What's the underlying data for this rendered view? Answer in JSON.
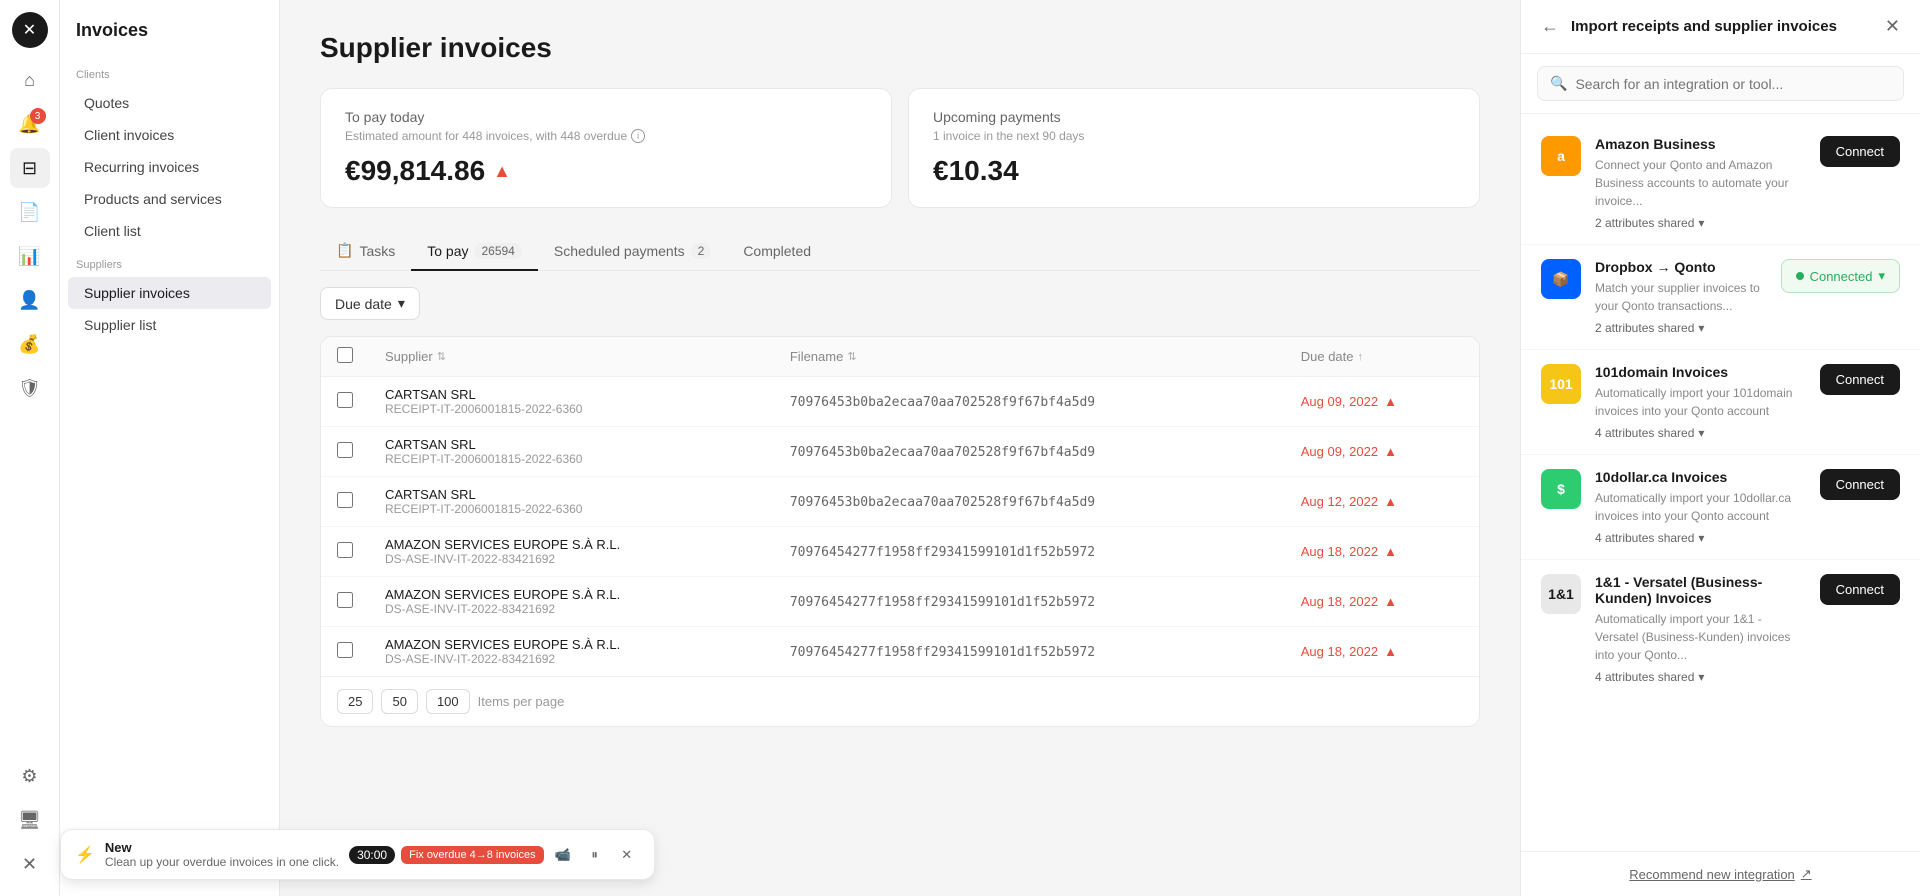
{
  "app": {
    "title": "Invoices"
  },
  "sidebar": {
    "title": "Invoices",
    "clients_label": "Clients",
    "clients_items": [
      {
        "id": "quotes",
        "label": "Quotes",
        "active": false
      },
      {
        "id": "client-invoices",
        "label": "Client invoices",
        "active": false
      },
      {
        "id": "recurring-invoices",
        "label": "Recurring invoices",
        "active": false
      },
      {
        "id": "products-services",
        "label": "Products and services",
        "active": false
      },
      {
        "id": "client-list",
        "label": "Client list",
        "active": false
      }
    ],
    "suppliers_label": "Suppliers",
    "suppliers_items": [
      {
        "id": "supplier-invoices",
        "label": "Supplier invoices",
        "active": true
      },
      {
        "id": "supplier-list",
        "label": "Supplier list",
        "active": false
      }
    ]
  },
  "main": {
    "page_title": "Supplier invoices",
    "cards": {
      "to_pay": {
        "title": "To pay today",
        "subtitle": "Estimated amount for 448 invoices, with 448 overdue",
        "amount": "€99,814.86",
        "warning": true
      },
      "upcoming": {
        "title": "Upcoming payments",
        "subtitle": "1 invoice in the next 90 days",
        "amount": "€10.34",
        "warning": false
      }
    },
    "tabs": [
      {
        "id": "tasks",
        "label": "Tasks",
        "icon": "📋",
        "badge": null,
        "active": false
      },
      {
        "id": "to-pay",
        "label": "To pay",
        "badge": "26594",
        "active": true
      },
      {
        "id": "scheduled",
        "label": "Scheduled payments",
        "badge": "2",
        "active": false
      },
      {
        "id": "completed",
        "label": "Completed",
        "badge": null,
        "active": false
      }
    ],
    "filter": {
      "label": "Due date",
      "icon": "▾"
    },
    "table": {
      "columns": [
        {
          "id": "checkbox",
          "label": ""
        },
        {
          "id": "supplier",
          "label": "Supplier"
        },
        {
          "id": "filename",
          "label": "Filename"
        },
        {
          "id": "due-date",
          "label": "Due date"
        }
      ],
      "rows": [
        {
          "supplier_name": "CARTSAN SRL",
          "supplier_ref": "RECEIPT-IT-2006001815-2022-6360",
          "filename": "70976453b0ba2ecaa70aa702528f9f67bf4a5d9",
          "due_date": "Aug 09, 2022",
          "overdue": true
        },
        {
          "supplier_name": "CARTSAN SRL",
          "supplier_ref": "RECEIPT-IT-2006001815-2022-6360",
          "filename": "70976453b0ba2ecaa70aa702528f9f67bf4a5d9",
          "due_date": "Aug 09, 2022",
          "overdue": true
        },
        {
          "supplier_name": "CARTSAN SRL",
          "supplier_ref": "RECEIPT-IT-2006001815-2022-6360",
          "filename": "70976453b0ba2ecaa70aa702528f9f67bf4a5d9",
          "due_date": "Aug 12, 2022",
          "overdue": true
        },
        {
          "supplier_name": "AMAZON SERVICES EUROPE S.À R.L.",
          "supplier_ref": "DS-ASE-INV-IT-2022-83421692",
          "filename": "70976454277f1958ff29341599101d1f52b5972",
          "due_date": "Aug 18, 2022",
          "overdue": true
        },
        {
          "supplier_name": "AMAZON SERVICES EUROPE S.À R.L.",
          "supplier_ref": "DS-ASE-INV-IT-2022-83421692",
          "filename": "70976454277f1958ff29341599101d1f52b5972",
          "due_date": "Aug 18, 2022",
          "overdue": true
        },
        {
          "supplier_name": "AMAZON SERVICES EUROPE S.À R.L.",
          "supplier_ref": "DS-ASE-INV-IT-2022-83421692",
          "filename": "70976454277f1958ff29341599101d1f52b5972",
          "due_date": "Aug 18, 2022",
          "overdue": true
        }
      ]
    },
    "pagination": {
      "options": [
        "25",
        "50",
        "100"
      ],
      "per_page_label": "Items per page"
    }
  },
  "right_panel": {
    "title": "Import receipts and supplier invoices",
    "search_placeholder": "Search for an integration or tool...",
    "integrations": [
      {
        "id": "amazon-business",
        "name": "Amazon Business",
        "description": "Connect your Qonto and Amazon Business accounts to automate your invoice...",
        "attrs": "2 attributes shared",
        "status": "connect",
        "logo_text": "a",
        "logo_bg": "#ff9900"
      },
      {
        "id": "dropbox-qonto",
        "name": "Dropbox → Qonto",
        "description": "Match your supplier invoices to your Qonto transactions...",
        "attrs": "2 attributes shared",
        "status": "connected",
        "logo_text": "📦",
        "logo_bg": "#0061ff"
      },
      {
        "id": "101domain",
        "name": "101domain Invoices",
        "description": "Automatically import your 101domain invoices into your Qonto account",
        "attrs": "4 attributes shared",
        "status": "connect",
        "logo_text": "101",
        "logo_bg": "#f5c518"
      },
      {
        "id": "10dollar",
        "name": "10dollar.ca Invoices",
        "description": "Automatically import your 10dollar.ca invoices into your Qonto account",
        "attrs": "4 attributes shared",
        "status": "connect",
        "logo_text": "$",
        "logo_bg": "#2ecc71"
      },
      {
        "id": "versatel",
        "name": "1&1 - Versatel (Business-Kunden) Invoices",
        "description": "Automatically import your 1&1 - Versatel (Business-Kunden) invoices into your Qonto...",
        "attrs": "4 attributes shared",
        "status": "connect",
        "logo_text": "1&1",
        "logo_bg": "#e8e8e8"
      }
    ],
    "footer_link": "Recommend new integration",
    "connected_label": "Connected",
    "connect_label": "Connect",
    "chevron_down": "▾"
  },
  "notification": {
    "icon": "⚡",
    "label": "New",
    "text": "Clean up your overdue invoices in one click.",
    "time": "30:00",
    "action_label": "Fix overdue 4→8 invoices",
    "controls": [
      "📹",
      "⏸",
      "✕"
    ]
  },
  "icon_bar": {
    "badge_count": "3",
    "items": [
      {
        "id": "home",
        "icon": "⊞",
        "label": "home"
      },
      {
        "id": "bell",
        "icon": "🔔",
        "label": "notifications",
        "badge": "3"
      },
      {
        "id": "dashboard",
        "icon": "⊡",
        "label": "dashboard"
      },
      {
        "id": "invoices",
        "icon": "📄",
        "label": "invoices"
      },
      {
        "id": "analytics",
        "icon": "📊",
        "label": "analytics"
      },
      {
        "id": "people",
        "icon": "👤",
        "label": "people"
      },
      {
        "id": "savings",
        "icon": "💰",
        "label": "savings"
      },
      {
        "id": "security",
        "icon": "🛡",
        "label": "security"
      }
    ]
  }
}
